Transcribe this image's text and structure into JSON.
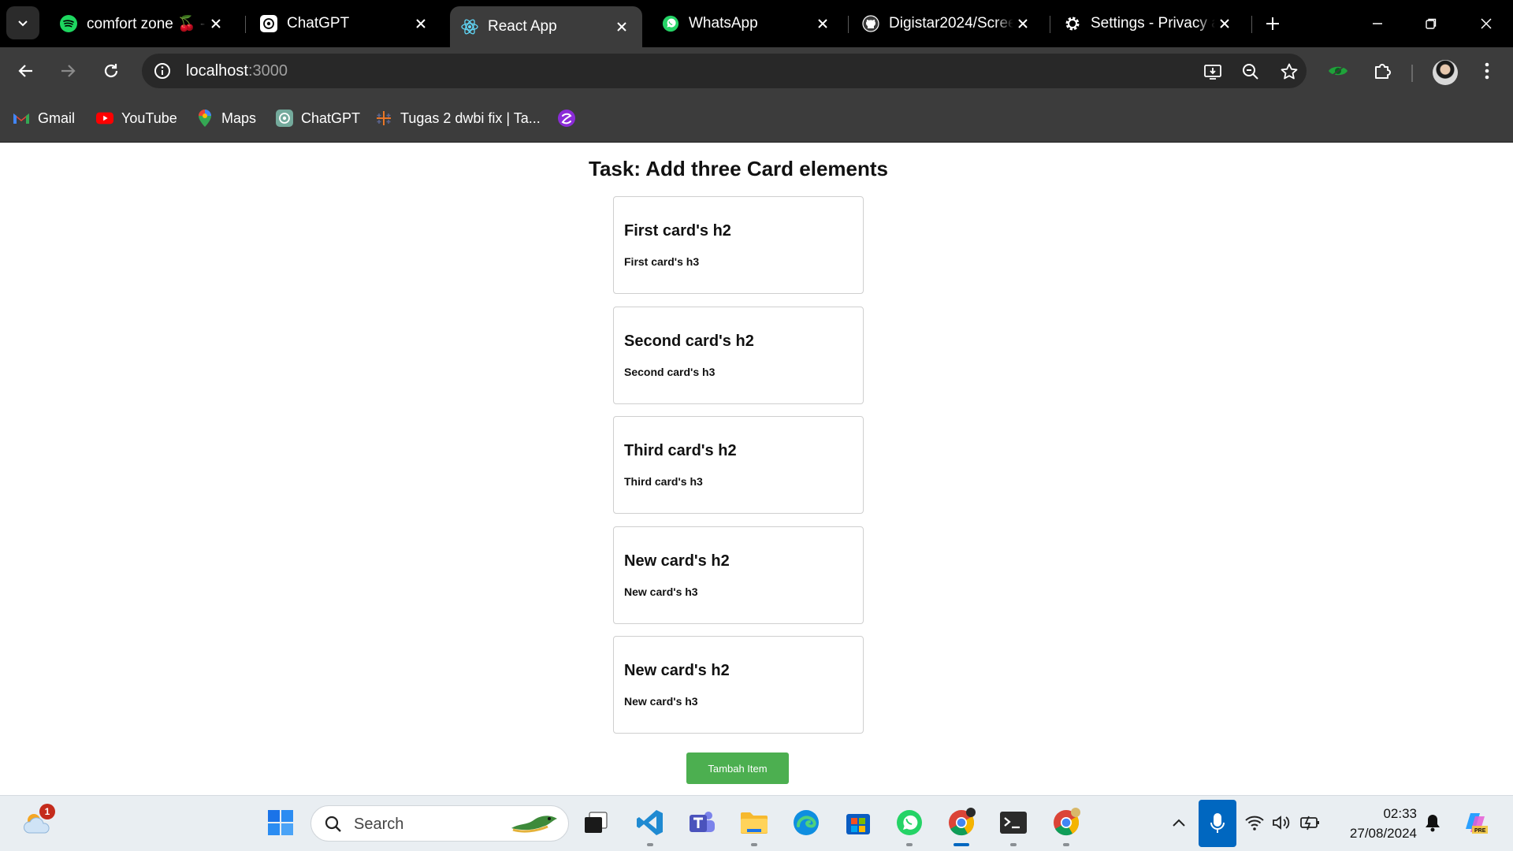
{
  "browser": {
    "tabs": [
      {
        "title": "comfort zone 🍒 - ",
        "icon": "spotify-icon"
      },
      {
        "title": "ChatGPT",
        "icon": "chatgpt-icon"
      },
      {
        "title": "React App",
        "icon": "react-icon",
        "active": true
      },
      {
        "title": "WhatsApp",
        "icon": "whatsapp-icon"
      },
      {
        "title": "Digistar2024/Scree",
        "icon": "github-icon"
      },
      {
        "title": "Settings - Privacy a",
        "icon": "gear-icon"
      }
    ],
    "address": {
      "host": "localhost",
      "port": ":3000"
    },
    "bookmarks": [
      {
        "label": "Gmail",
        "icon": "gmail-icon"
      },
      {
        "label": "YouTube",
        "icon": "youtube-icon"
      },
      {
        "label": "Maps",
        "icon": "maps-icon"
      },
      {
        "label": "ChatGPT",
        "icon": "chatgpt-icon"
      },
      {
        "label": "Tugas 2 dwbi fix | Ta...",
        "icon": "tableau-icon"
      },
      {
        "label": "",
        "icon": "app-icon"
      }
    ]
  },
  "page": {
    "title": "Task: Add three Card elements",
    "cards": [
      {
        "h2": "First card's h2",
        "h3": "First card's h3"
      },
      {
        "h2": "Second card's h2",
        "h3": "Second card's h3"
      },
      {
        "h2": "Third card's h2",
        "h3": "Third card's h3"
      },
      {
        "h2": "New card's h2",
        "h3": "New card's h3"
      },
      {
        "h2": "New card's h2",
        "h3": "New card's h3"
      }
    ],
    "add_button": "Tambah Item",
    "button_color": "#4caf50"
  },
  "taskbar": {
    "search_label": "Search",
    "weather_badge": "1",
    "time": "02:33",
    "date": "27/08/2024",
    "accent": "#0067c0"
  }
}
